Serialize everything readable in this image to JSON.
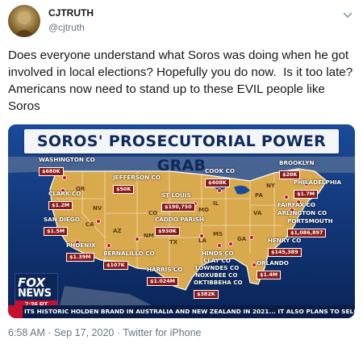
{
  "account": {
    "name": "CJTRUTH",
    "handle": "@cjtruth"
  },
  "tweet": {
    "text": "Does everyone understand what Soros was doing when he got involved in local elections? Hopefully you do now.  Is it too late? Americans now need to stand up to these EVIL people like Soros"
  },
  "media": {
    "title": "SOROS' PROSECUTORIAL POWER GRAB",
    "labels": [
      {
        "name": "WASHINGTON CO",
        "value": "$680K"
      },
      {
        "name": "JEFFERSON CO",
        "value": "$50K"
      },
      {
        "name": "COOK CO",
        "value": "$408K"
      },
      {
        "name": "BROOKLYN",
        "value": "$20K"
      },
      {
        "name": "PHILADELPHIA",
        "value": "$1.7M"
      },
      {
        "name": "CLARK CO",
        "value": "$1.2M"
      },
      {
        "name": "ST LOUIS",
        "value": "$190,750"
      },
      {
        "name": "FAIRFAX CO",
        "value": ""
      },
      {
        "name": "ARLINGTON CO",
        "value": ""
      },
      {
        "name": "PORTSMOUTH",
        "value": "$1,086,897"
      },
      {
        "name": "SAN DIEGO",
        "value": "$1.5M"
      },
      {
        "name": "CADDO PARISH",
        "value": "$930K"
      },
      {
        "name": "HENRY CO",
        "value": "$145,389"
      },
      {
        "name": "PHOENIX",
        "value": "$1.39M"
      },
      {
        "name": "BERNALILLO CO",
        "value": "$107K"
      },
      {
        "name": "HINDS CO",
        "value": ""
      },
      {
        "name": "CLAY CO",
        "value": ""
      },
      {
        "name": "LOWNDES CO",
        "value": ""
      },
      {
        "name": "NOXUBEE CO",
        "value": ""
      },
      {
        "name": "OKTIBBEHA CO",
        "value": "$382K"
      },
      {
        "name": "ORLANDO",
        "value": "$1.4M"
      },
      {
        "name": "HARRIS CO",
        "value": "$1.024M"
      }
    ],
    "states": [
      "OR",
      "NV",
      "CA",
      "AZ",
      "CO",
      "NM",
      "TX",
      "MO",
      "IL",
      "LA",
      "MS",
      "GA",
      "NY",
      "PA",
      "VA"
    ],
    "logo_line1": "FOX",
    "logo_line2": "NEWS",
    "time": "7:26 PT",
    "ticker": "ITS HISTORIC HOLDEN BRAND IN AUSTRALIA AND NEW ZEALAND IN 2021...  IT ALSO PLANS TO SELL ITS I"
  },
  "footer": {
    "timestamp": "6:58 AM · Sep 17, 2020 · Twitter for iPhone"
  },
  "colors": {
    "map_background": "#0b2e6e",
    "states": "#d9a94e",
    "value_badge": "#8b1a1a",
    "ticker": "#0a1d47",
    "accent_red": "#c8102e"
  }
}
